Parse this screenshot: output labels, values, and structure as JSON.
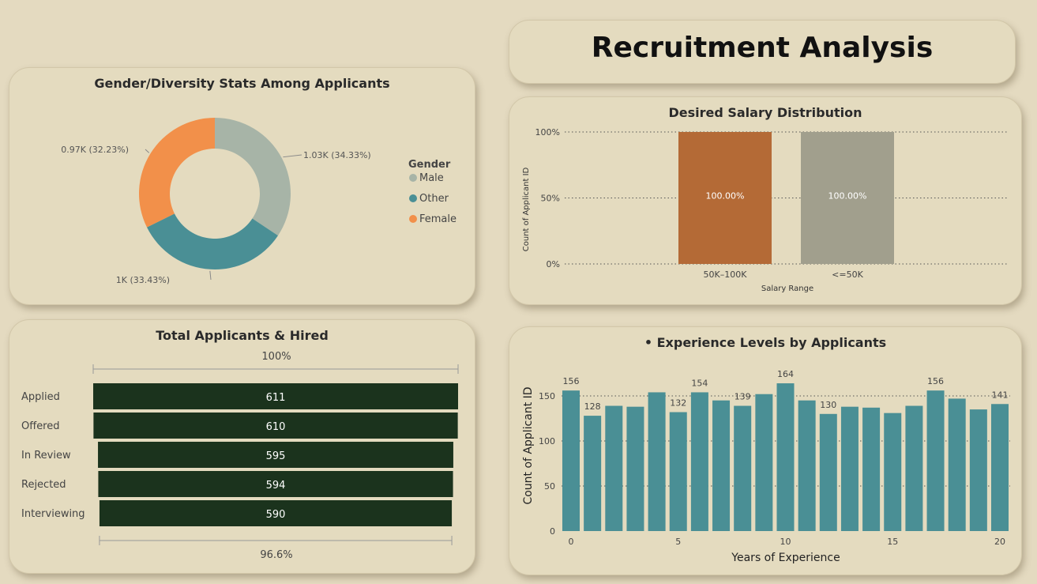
{
  "title": "Recruitment Analysis",
  "colors": {
    "background": "#e4dac0",
    "male": "#a7b4a7",
    "other": "#4a8f95",
    "female": "#f2904a",
    "funnel_bar": "#1b331d",
    "salary_bar_1": "#b46a36",
    "salary_bar_2": "#a19f8d",
    "experience_bar": "#4a8f95"
  },
  "gender": {
    "title": "Gender/Diversity Stats Among Applicants",
    "legend_title": "Gender",
    "chart_data": {
      "type": "pie",
      "title": "Gender/Diversity Stats Among Applicants",
      "slices": [
        {
          "name": "Male",
          "value": 1030,
          "percent": 34.33,
          "label": "1.03K (34.33%)"
        },
        {
          "name": "Other",
          "value": 1000,
          "percent": 33.43,
          "label": "1K (33.43%)"
        },
        {
          "name": "Female",
          "value": 970,
          "percent": 32.23,
          "label": "0.97K (32.23%)"
        }
      ]
    }
  },
  "funnel": {
    "title": "Total Applicants & Hired",
    "top_label": "100%",
    "bottom_label": "96.6%",
    "chart_data": {
      "type": "bar",
      "title": "Total Applicants & Hired",
      "categories": [
        "Applied",
        "Offered",
        "In Review",
        "Rejected",
        "Interviewing"
      ],
      "values": [
        611,
        610,
        595,
        594,
        590
      ]
    }
  },
  "salary": {
    "title": "Desired Salary Distribution",
    "chart_data": {
      "type": "bar",
      "title": "Desired Salary Distribution",
      "xlabel": "Salary Range",
      "ylabel": "Count of Applicant ID",
      "categories": [
        "50K–100K",
        "<=50K"
      ],
      "values": [
        100,
        100
      ],
      "data_labels": [
        "100.00%",
        "100.00%"
      ],
      "yticks": [
        "0%",
        "50%",
        "100%"
      ],
      "ylim": [
        0,
        100
      ]
    }
  },
  "experience": {
    "title": "• Experience Levels by Applicants",
    "chart_data": {
      "type": "bar",
      "title": "• Experience Levels by Applicants",
      "xlabel": "Years of Experience",
      "ylabel": "Count of Applicant ID",
      "x": [
        0,
        1,
        2,
        3,
        4,
        5,
        6,
        7,
        8,
        9,
        10,
        11,
        12,
        13,
        14,
        15,
        16,
        17,
        18,
        19,
        20
      ],
      "values": [
        156,
        128,
        139,
        138,
        154,
        132,
        154,
        145,
        139,
        152,
        164,
        145,
        130,
        138,
        137,
        131,
        139,
        156,
        147,
        135,
        141
      ],
      "labeled_points": [
        0,
        1,
        5,
        6,
        8,
        10,
        12,
        17,
        20
      ],
      "yticks": [
        0,
        50,
        100,
        150
      ],
      "xticks": [
        0,
        5,
        10,
        15,
        20
      ],
      "ylim": [
        0,
        175
      ]
    }
  }
}
